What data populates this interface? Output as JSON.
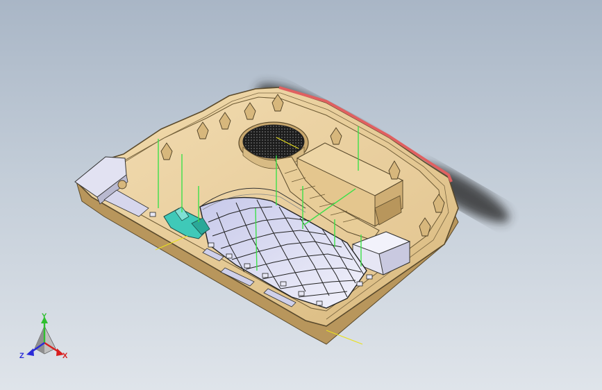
{
  "viewport": {
    "background_top": "#a9b6c6",
    "background_bottom": "#dfe4ea"
  },
  "model": {
    "shell_color": "#ecd2a0",
    "shell_edge": "#5a4a2c",
    "panel_color": "#e0e0f4",
    "grid_color": "#222222",
    "accent_edge": "#e06060",
    "highlight_part": "#3fc9b8",
    "guide_line": "#3ce04a",
    "shadow": "#2a2a2a"
  },
  "triad": {
    "x_label": "X",
    "y_label": "Y",
    "z_label": "Z",
    "x_color": "#d81e1e",
    "y_color": "#2fbf2f",
    "z_color": "#2a2ad8"
  }
}
